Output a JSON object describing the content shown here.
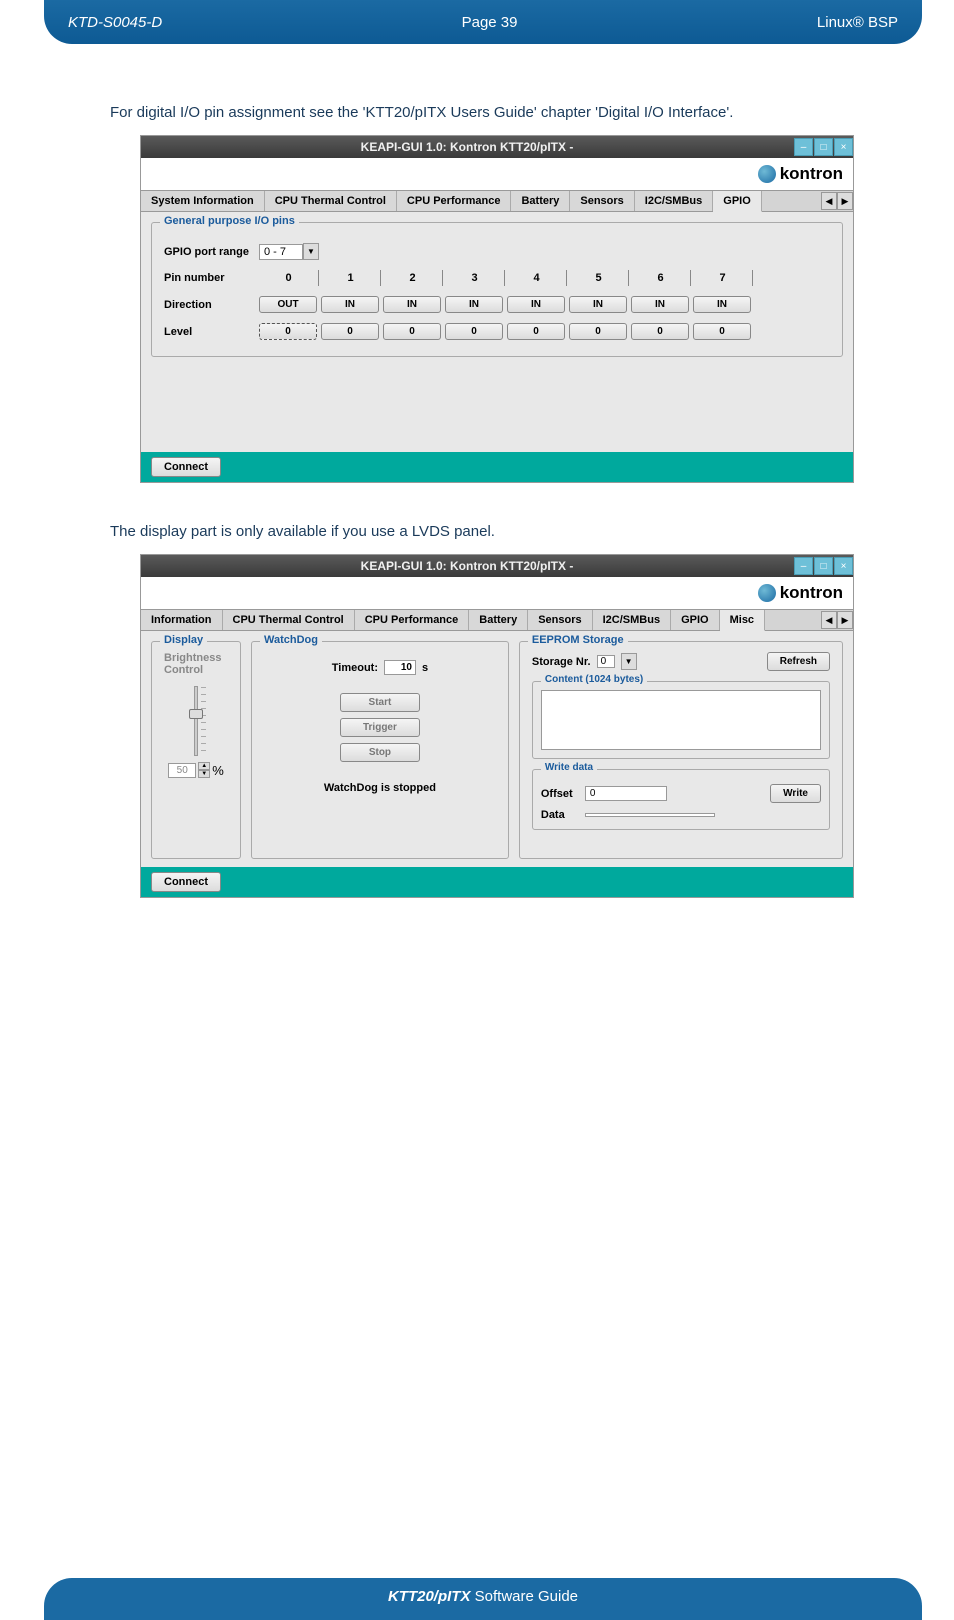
{
  "header": {
    "doc_id": "KTD-S0045-D",
    "page": "Page 39",
    "product": "Linux® BSP"
  },
  "intro1": "For digital I/O pin assignment see the 'KTT20/pITX Users Guide' chapter 'Digital I/O Interface'.",
  "intro2": "The display part is only available if you use a LVDS panel.",
  "app1": {
    "title": "KEAPI-GUI 1.0: Kontron KTT20/pITX -",
    "brand": "kontron",
    "tabs": [
      "System Information",
      "CPU Thermal Control",
      "CPU Performance",
      "Battery",
      "Sensors",
      "I2C/SMBus",
      "GPIO"
    ],
    "active_tab": 6,
    "group_title": "General purpose I/O pins",
    "port_label": "GPIO port range",
    "port_value": "0 - 7",
    "pin_label": "Pin number",
    "dir_label": "Direction",
    "lvl_label": "Level",
    "pins": [
      "0",
      "1",
      "2",
      "3",
      "4",
      "5",
      "6",
      "7"
    ],
    "dirs": [
      "OUT",
      "IN",
      "IN",
      "IN",
      "IN",
      "IN",
      "IN",
      "IN"
    ],
    "lvls": [
      "0",
      "0",
      "0",
      "0",
      "0",
      "0",
      "0",
      "0"
    ],
    "connect": "Connect"
  },
  "app2": {
    "title": "KEAPI-GUI 1.0: Kontron KTT20/pITX -",
    "brand": "kontron",
    "tabs": [
      "Information",
      "CPU Thermal Control",
      "CPU Performance",
      "Battery",
      "Sensors",
      "I2C/SMBus",
      "GPIO",
      "Misc"
    ],
    "active_tab": 7,
    "display": {
      "title": "Display",
      "bright": "Brightness Control",
      "value": "50",
      "pct": "%"
    },
    "wd": {
      "title": "WatchDog",
      "timeout_label": "Timeout:",
      "timeout_val": "10",
      "unit": "s",
      "start": "Start",
      "trigger": "Trigger",
      "stop": "Stop",
      "status": "WatchDog is stopped"
    },
    "eep": {
      "title": "EEPROM Storage",
      "stor_label": "Storage Nr.",
      "stor_val": "0",
      "refresh": "Refresh",
      "content_title": "Content (1024 bytes)",
      "write_title": "Write data",
      "offset_label": "Offset",
      "offset_val": "0",
      "write": "Write",
      "data_label": "Data"
    },
    "connect": "Connect"
  },
  "footer": {
    "bold": "KTT20/pITX",
    "rest": " Software Guide"
  }
}
